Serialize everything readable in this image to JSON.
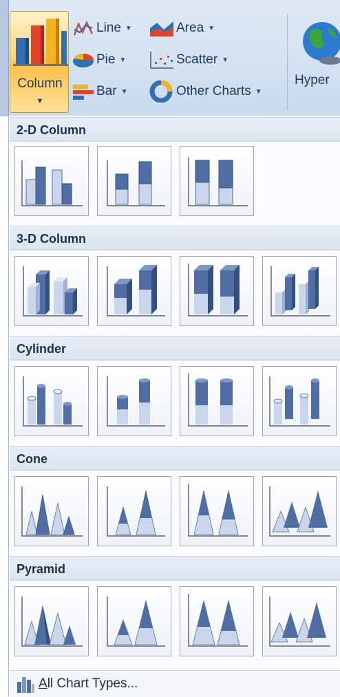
{
  "ribbon": {
    "column_label": "Column",
    "items": [
      {
        "label": "Line"
      },
      {
        "label": "Pie"
      },
      {
        "label": "Bar"
      },
      {
        "label": "Area"
      },
      {
        "label": "Scatter"
      },
      {
        "label": "Other Charts"
      }
    ],
    "hyperlink_label": "Hyper"
  },
  "gallery": {
    "sections": [
      {
        "title": "2-D Column",
        "items": [
          "Clustered Column",
          "Stacked Column",
          "100% Stacked Column"
        ]
      },
      {
        "title": "3-D Column",
        "items": [
          "3-D Clustered Column",
          "Stacked Column in 3-D",
          "100% Stacked Column in 3-D",
          "3-D Column"
        ]
      },
      {
        "title": "Cylinder",
        "items": [
          "Clustered Cylinder",
          "Stacked Cylinder",
          "100% Stacked Cylinder",
          "3-D Cylinder"
        ]
      },
      {
        "title": "Cone",
        "items": [
          "Clustered Cone",
          "Stacked Cone",
          "100% Stacked Cone",
          "3-D Cone"
        ]
      },
      {
        "title": "Pyramid",
        "items": [
          "Clustered Pyramid",
          "Stacked Pyramid",
          "100% Stacked Pyramid",
          "3-D Pyramid"
        ]
      }
    ],
    "footer": {
      "access_key": "A",
      "label_rest": "ll Chart Types..."
    }
  },
  "colors": {
    "accent_dark": "#4f6ea3",
    "accent_light": "#c4d2ea",
    "highlight": "#ffd67e"
  }
}
